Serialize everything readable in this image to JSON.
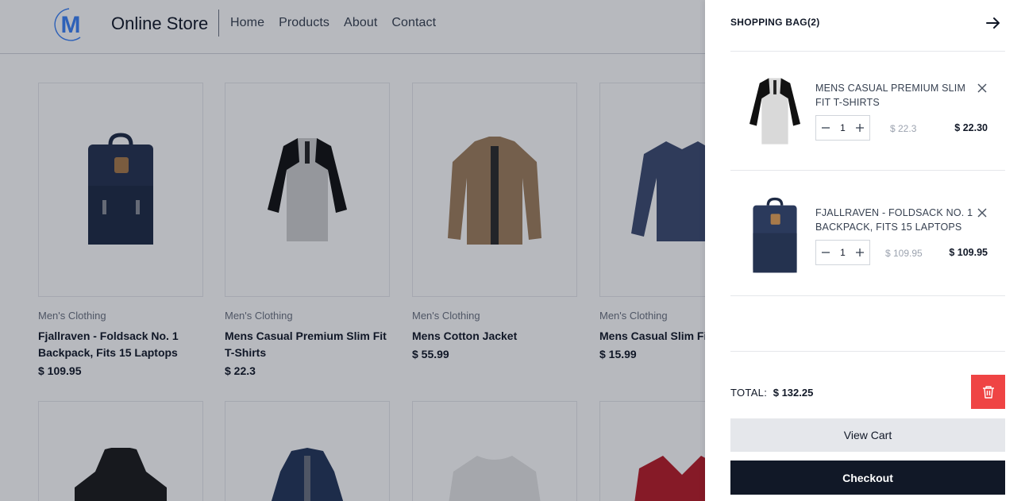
{
  "header": {
    "brand": "Online Store",
    "logo_letter": "M",
    "nav": [
      "Home",
      "Products",
      "About",
      "Contact"
    ]
  },
  "products": [
    {
      "category": "Men's Clothing",
      "title": "Fjallraven - Foldsack No. 1 Backpack, Fits 15 Laptops",
      "price": "$ 109.95",
      "image": "backpack-icon"
    },
    {
      "category": "Men's Clothing",
      "title": "Mens Casual Premium Slim Fit T-Shirts",
      "price": "$ 22.3",
      "image": "henley-shirt-icon"
    },
    {
      "category": "Men's Clothing",
      "title": "Mens Cotton Jacket",
      "price": "$ 55.99",
      "image": "jacket-icon"
    },
    {
      "category": "Men's Clothing",
      "title": "Mens Casual Slim Fit",
      "price": "$ 15.99",
      "image": "long-sleeve-tee-icon"
    }
  ],
  "cart": {
    "title": "SHOPPING BAG(2)",
    "items": [
      {
        "name": "MENS CASUAL PREMIUM SLIM FIT T-SHIRTS",
        "qty": "1",
        "unit_price": "$ 22.3",
        "line_total": "$ 22.30",
        "image": "henley-shirt-icon"
      },
      {
        "name": "FJALLRAVEN - FOLDSACK NO. 1 BACKPACK, FITS 15 LAPTOPS",
        "qty": "1",
        "unit_price": "$ 109.95",
        "line_total": "$ 109.95",
        "image": "backpack-icon"
      }
    ],
    "total_label": "TOTAL:",
    "total_value": "$ 132.25",
    "view_cart": "View Cart",
    "checkout": "Checkout"
  },
  "colors": {
    "accent_blue": "#3b82f6",
    "danger": "#ef4444",
    "dark": "#111827"
  }
}
